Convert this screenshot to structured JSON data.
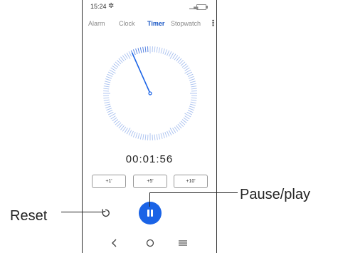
{
  "status_bar": {
    "time": "15:24",
    "gear_icon": "gear-icon",
    "signal_icon": "signal-icon",
    "battery_icon": "battery-icon"
  },
  "tabs": [
    {
      "label": "Alarm",
      "active": false
    },
    {
      "label": "Clock",
      "active": false
    },
    {
      "label": "Timer",
      "active": true
    },
    {
      "label": "Stopwatch",
      "active": false
    }
  ],
  "overflow_menu_icon": "more-vert-icon",
  "timer": {
    "display": "00:01:56",
    "remaining_seconds": 116,
    "dial_total_seconds": 60
  },
  "add_buttons": [
    {
      "label": "+1'"
    },
    {
      "label": "+5'"
    },
    {
      "label": "+10'"
    }
  ],
  "controls": {
    "reset_icon": "reset-icon",
    "pause_icon": "pause-icon"
  },
  "nav": {
    "back_icon": "back-icon",
    "home_icon": "home-icon",
    "recents_icon": "recents-icon"
  },
  "callouts": {
    "reset": "Reset",
    "pause_play": "Pause/play"
  },
  "colors": {
    "accent": "#1a63e6",
    "tick_active": "#4a7ae0"
  }
}
